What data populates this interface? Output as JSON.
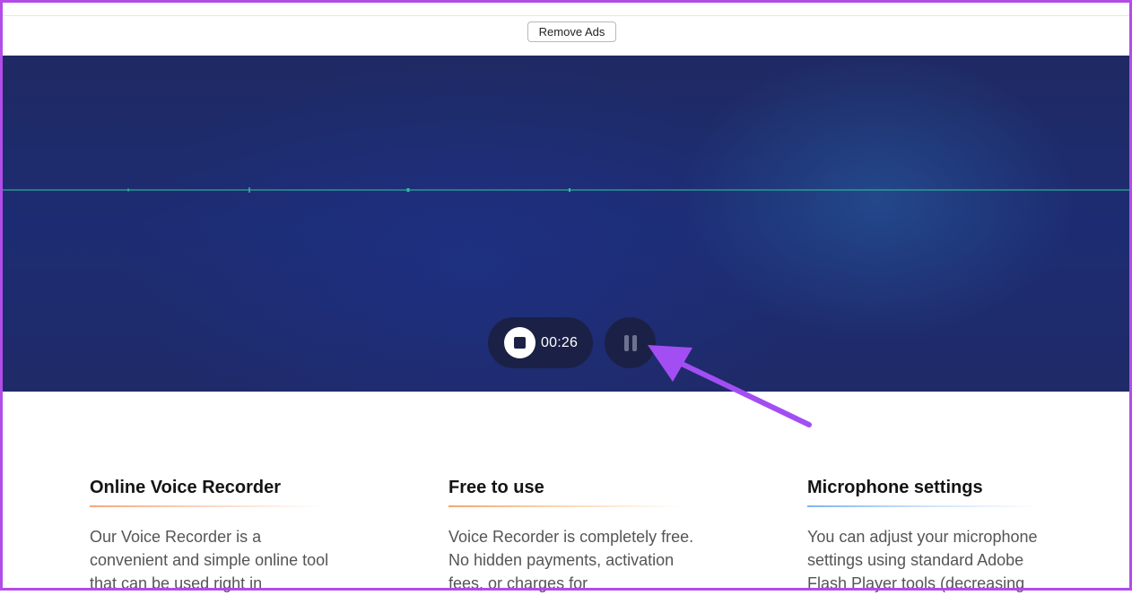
{
  "header": {
    "remove_ads_label": "Remove Ads"
  },
  "recorder": {
    "timer": "00:26",
    "stop_icon": "stop-icon",
    "pause_icon": "pause-icon",
    "waveform_color": "#2fbf9a",
    "background_color": "#1f2a68"
  },
  "annotation": {
    "arrow_color": "#a24ef3"
  },
  "features": [
    {
      "title": "Online Voice Recorder",
      "text": "Our Voice Recorder is a convenient and simple online tool that can be used right in",
      "accent": [
        "#f5a77b",
        "#f9d7c4"
      ]
    },
    {
      "title": "Free to use",
      "text": "Voice Recorder is completely free. No hidden payments, activation fees, or charges for",
      "accent": [
        "#f2a86a",
        "#fbd9b6"
      ]
    },
    {
      "title": "Microphone settings",
      "text": "You can adjust your microphone settings using standard Adobe Flash Player tools (decreasing",
      "accent": [
        "#7fb4f0",
        "#cfe2f8"
      ]
    }
  ]
}
